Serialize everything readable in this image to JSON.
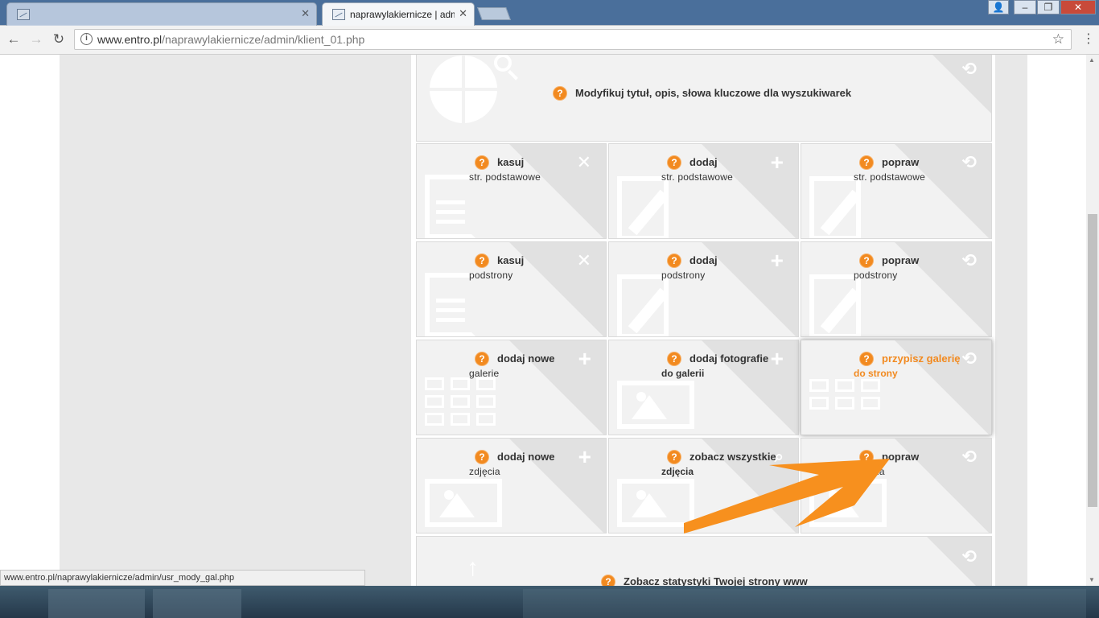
{
  "browser": {
    "tabs": [
      {
        "title": ""
      },
      {
        "title": "naprawylakiernicze | adm"
      }
    ],
    "url_host": "www.entro.pl",
    "url_path": "/naprawylakiernicze/admin/klient_01.php",
    "status_url": "www.entro.pl/naprawylakiernicze/admin/usr_mody_gal.php"
  },
  "tiles": {
    "seo": {
      "title": "Modyfikuj tytuł, opis, słowa kluczowe dla wyszukiwarek"
    },
    "r1c1": {
      "title": "kasuj",
      "subtitle": "str. podstawowe"
    },
    "r1c2": {
      "title": "dodaj",
      "subtitle": "str. podstawowe"
    },
    "r1c3": {
      "title": "popraw",
      "subtitle": "str. podstawowe"
    },
    "r2c1": {
      "title": "kasuj",
      "subtitle": "podstrony"
    },
    "r2c2": {
      "title": "dodaj",
      "subtitle": "podstrony"
    },
    "r2c3": {
      "title": "popraw",
      "subtitle": "podstrony"
    },
    "r3c1": {
      "title": "dodaj nowe",
      "subtitle": "galerie"
    },
    "r3c2": {
      "title": "dodaj fotografie",
      "subtitle": "do galerii"
    },
    "r3c3": {
      "title": "przypisz galerię",
      "subtitle": "do strony"
    },
    "r4c1": {
      "title": "dodaj nowe",
      "subtitle": "zdjęcia"
    },
    "r4c2": {
      "title": "zobacz wszystkie",
      "subtitle": "zdjęcia"
    },
    "r4c3": {
      "title": "popraw",
      "subtitle": "zdjęcia"
    },
    "stats": {
      "title": "Zobacz statystyki Twojej strony www"
    }
  },
  "colors": {
    "accent": "#f28a20",
    "tile_bg": "#f2f2f2",
    "panel_bg": "#e8e8e8"
  },
  "icons": {
    "delete": "x-icon",
    "add": "plus-icon",
    "edit": "refresh-icon",
    "help": "question-icon"
  }
}
